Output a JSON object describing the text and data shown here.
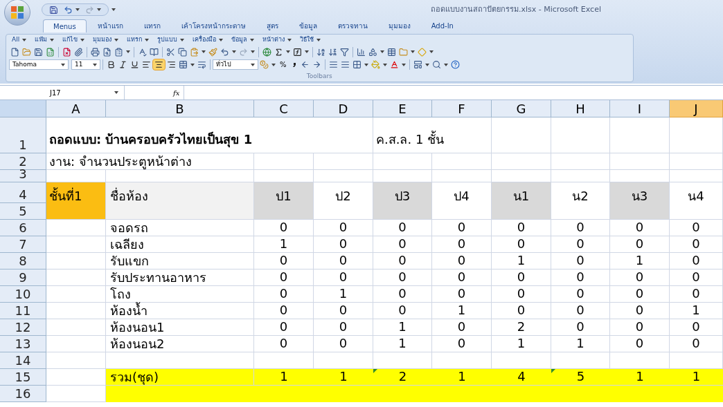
{
  "window": {
    "title": "ถอดแบบงานสถาปัตยกรรม.xlsx - Microsoft Excel"
  },
  "ribbon_tabs": [
    {
      "label": "Menus",
      "selected": true
    },
    {
      "label": "หน้าแรก",
      "selected": false
    },
    {
      "label": "แทรก",
      "selected": false
    },
    {
      "label": "เค้าโครงหน้ากระดาษ",
      "selected": false
    },
    {
      "label": "สูตร",
      "selected": false
    },
    {
      "label": "ข้อมูล",
      "selected": false
    },
    {
      "label": "ตรวจทาน",
      "selected": false
    },
    {
      "label": "มุมมอง",
      "selected": false
    },
    {
      "label": "Add-In",
      "selected": false
    }
  ],
  "menus": [
    "All",
    "แฟ้ม",
    "แก้ไข",
    "มุมมอง",
    "แทรก",
    "รูปแบบ",
    "เครื่องมือ",
    "ข้อมูล",
    "หน้าต่าง",
    "วิธีใช้"
  ],
  "toolbar": {
    "font": "Tahoma",
    "font_size": "11",
    "number_format": "ทั่วไป",
    "percent": "%",
    "group_label": "Toolbars",
    "align_buttons": [
      {
        "selected": false
      },
      {
        "selected": true
      },
      {
        "selected": false
      }
    ]
  },
  "formula_bar": {
    "name_box": "J17",
    "function_label": "fx"
  },
  "sheet": {
    "columns": [
      {
        "label": "A",
        "selected": false
      },
      {
        "label": "B",
        "selected": false
      },
      {
        "label": "C",
        "selected": false
      },
      {
        "label": "D",
        "selected": false
      },
      {
        "label": "E",
        "selected": false
      },
      {
        "label": "F",
        "selected": false
      },
      {
        "label": "G",
        "selected": false
      },
      {
        "label": "H",
        "selected": false
      },
      {
        "label": "I",
        "selected": false
      },
      {
        "label": "J",
        "selected": true
      }
    ],
    "row_numbers": [
      "1",
      "2",
      "3",
      "4",
      "5",
      "6",
      "7",
      "8",
      "9",
      "10",
      "11",
      "12",
      "13",
      "14",
      "15",
      "16"
    ],
    "title": "ถอดแบบ: บ้านครอบครัวไทยเป็นสุข 1",
    "structure": "ค.ส.ล. 1 ชั้น",
    "task": "งาน: จำนวนประตูหน้าต่าง",
    "floor": "ชั้นที่1",
    "room_header": "ชื่อห้อง",
    "openings": [
      {
        "label": "ป1",
        "shaded": true
      },
      {
        "label": "ป2",
        "shaded": false
      },
      {
        "label": "ป3",
        "shaded": true
      },
      {
        "label": "ป4",
        "shaded": false
      },
      {
        "label": "น1",
        "shaded": true
      },
      {
        "label": "น2",
        "shaded": false
      },
      {
        "label": "น3",
        "shaded": true
      },
      {
        "label": "น4",
        "shaded": false
      }
    ],
    "rooms": [
      {
        "name": "จอดรถ",
        "values": [
          "0",
          "0",
          "0",
          "0",
          "0",
          "0",
          "0",
          "0"
        ]
      },
      {
        "name": "เฉลียง",
        "values": [
          "1",
          "0",
          "0",
          "0",
          "0",
          "0",
          "0",
          "0"
        ]
      },
      {
        "name": "รับแขก",
        "values": [
          "0",
          "0",
          "0",
          "0",
          "1",
          "0",
          "1",
          "0"
        ]
      },
      {
        "name": "รับประทานอาหาร",
        "values": [
          "0",
          "0",
          "0",
          "0",
          "0",
          "0",
          "0",
          "0"
        ]
      },
      {
        "name": "โถง",
        "values": [
          "0",
          "1",
          "0",
          "0",
          "0",
          "0",
          "0",
          "0"
        ]
      },
      {
        "name": "ห้องน้ำ",
        "values": [
          "0",
          "0",
          "0",
          "1",
          "0",
          "0",
          "0",
          "1"
        ]
      },
      {
        "name": "ห้องนอน1",
        "values": [
          "0",
          "0",
          "1",
          "0",
          "2",
          "0",
          "0",
          "0"
        ]
      },
      {
        "name": "ห้องนอน2",
        "values": [
          "0",
          "0",
          "1",
          "0",
          "1",
          "1",
          "0",
          "0"
        ]
      }
    ],
    "total": {
      "label": "รวม(ชุด)",
      "cells": [
        {
          "value": "1",
          "flagged": false
        },
        {
          "value": "1",
          "flagged": false
        },
        {
          "value": "2",
          "flagged": true
        },
        {
          "value": "1",
          "flagged": false
        },
        {
          "value": "4",
          "flagged": false
        },
        {
          "value": "5",
          "flagged": true
        },
        {
          "value": "1",
          "flagged": false
        },
        {
          "value": "1",
          "flagged": false
        }
      ]
    }
  }
}
